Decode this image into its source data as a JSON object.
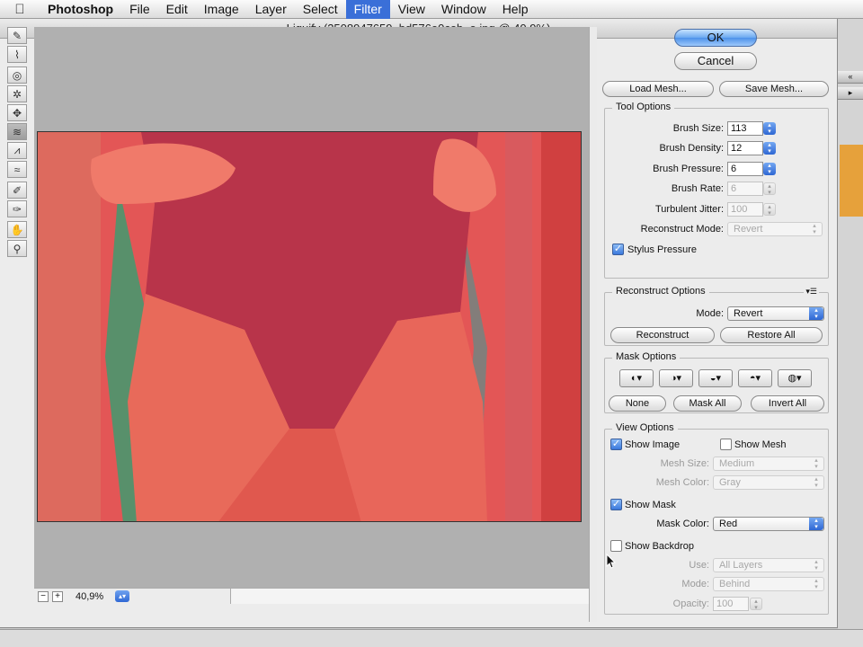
{
  "menubar": {
    "apple_icon": "apple-logo-icon",
    "items": [
      "Photoshop",
      "File",
      "Edit",
      "Image",
      "Layer",
      "Select",
      "Filter",
      "View",
      "Window",
      "Help"
    ],
    "active": "Filter"
  },
  "window": {
    "title": "Liquify (3508947659_bd576e0ceb_o.jpg @ 40,9%)"
  },
  "toolbar": {
    "tools": [
      "forward-warp-tool-icon",
      "reconstruct-tool-icon",
      "twirl-clockwise-tool-icon",
      "pucker-tool-icon",
      "bloat-tool-icon",
      "push-left-tool-icon",
      "mirror-tool-icon",
      "turbulence-tool-icon",
      "freeze-mask-tool-icon",
      "thaw-mask-tool-icon",
      "hand-tool-icon",
      "zoom-tool-icon"
    ]
  },
  "zoom": {
    "value": "40,9%"
  },
  "buttons": {
    "ok": "OK",
    "cancel": "Cancel",
    "load_mesh": "Load Mesh...",
    "save_mesh": "Save Mesh..."
  },
  "tool_options": {
    "title": "Tool Options",
    "brush_size_label": "Brush Size:",
    "brush_size": "113",
    "brush_density_label": "Brush Density:",
    "brush_density": "12",
    "brush_pressure_label": "Brush Pressure:",
    "brush_pressure": "6",
    "brush_rate_label": "Brush Rate:",
    "brush_rate": "6",
    "turbulent_jitter_label": "Turbulent Jitter:",
    "turbulent_jitter": "100",
    "reconstruct_mode_label": "Reconstruct Mode:",
    "reconstruct_mode": "Revert",
    "stylus_pressure_label": "Stylus Pressure",
    "stylus_pressure": true
  },
  "reconstruct_options": {
    "title": "Reconstruct Options",
    "mode_label": "Mode:",
    "mode": "Revert",
    "reconstruct": "Reconstruct",
    "restore_all": "Restore All"
  },
  "mask_options": {
    "title": "Mask Options",
    "none": "None",
    "mask_all": "Mask All",
    "invert_all": "Invert All"
  },
  "view_options": {
    "title": "View Options",
    "show_image_label": "Show Image",
    "show_image": true,
    "show_mesh_label": "Show Mesh",
    "show_mesh": false,
    "mesh_size_label": "Mesh Size:",
    "mesh_size": "Medium",
    "mesh_color_label": "Mesh Color:",
    "mesh_color": "Gray",
    "show_mask_label": "Show Mask",
    "show_mask": true,
    "mask_color_label": "Mask Color:",
    "mask_color": "Red",
    "show_backdrop_label": "Show Backdrop",
    "show_backdrop": false,
    "use_label": "Use:",
    "use": "All Layers",
    "mode_label": "Mode:",
    "mode": "Behind",
    "opacity_label": "Opacity:",
    "opacity": "100"
  },
  "colors": {
    "mask_red": "#e65858",
    "menu_highlight": "#3a6fd8"
  }
}
